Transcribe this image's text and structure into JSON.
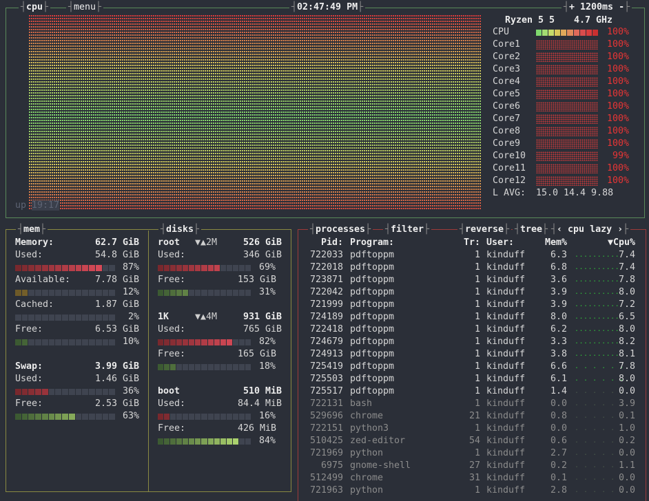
{
  "cpu_box": {
    "title": "cpu",
    "menu": "menu",
    "clock": "02:47:49 PM",
    "refresh": "+ 1200ms -",
    "model": "Ryzen 5 5",
    "freq": "4.7 GHz",
    "uptime_prefix": "up ",
    "uptime": "19:17",
    "cpu_label": "CPU",
    "cpu_pct": "100%",
    "cores": [
      {
        "name": "Core1",
        "pct": "100%"
      },
      {
        "name": "Core2",
        "pct": "100%"
      },
      {
        "name": "Core3",
        "pct": "100%"
      },
      {
        "name": "Core4",
        "pct": "100%"
      },
      {
        "name": "Core5",
        "pct": "100%"
      },
      {
        "name": "Core6",
        "pct": "100%"
      },
      {
        "name": "Core7",
        "pct": "100%"
      },
      {
        "name": "Core8",
        "pct": "100%"
      },
      {
        "name": "Core9",
        "pct": "100%"
      },
      {
        "name": "Core10",
        "pct": "99%"
      },
      {
        "name": "Core11",
        "pct": "100%"
      },
      {
        "name": "Core12",
        "pct": "100%"
      }
    ],
    "lavg_label": "L AVG:",
    "lavg": "15.0 14.4 9.88",
    "colors": {
      "low": "#7fd96e",
      "mid": "#d9c85a",
      "high": "#d83c3c"
    }
  },
  "mem": {
    "title": "mem",
    "memory_label": "Memory:",
    "memory_total": "62.7 GiB",
    "used_label": "Used:",
    "used_value": "54.8 GiB",
    "used_pct": "87%",
    "used_level": 0.87,
    "available_label": "Available:",
    "available_value": "7.78 GiB",
    "available_pct": "12%",
    "available_level": 0.12,
    "cached_label": "Cached:",
    "cached_value": "1.87 GiB",
    "cached_pct": "2%",
    "cached_level": 0.02,
    "free_label": "Free:",
    "free_value": "6.53 GiB",
    "free_pct": "10%",
    "free_level": 0.1,
    "swap_label": "Swap:",
    "swap_total": "3.99 GiB",
    "swap_used_label": "Used:",
    "swap_used_value": "1.46 GiB",
    "swap_used_pct": "36%",
    "swap_used_level": 0.36,
    "swap_free_label": "Free:",
    "swap_free_value": "2.53 GiB",
    "swap_free_pct": "63%",
    "swap_free_level": 0.63
  },
  "disks": {
    "title": "disks",
    "list": [
      {
        "name": "root",
        "io": "▼▲2M",
        "total": "526 GiB",
        "used_label": "Used:",
        "used": "346 GiB",
        "used_pct": "69%",
        "used_level": 0.69,
        "free_label": "Free:",
        "free": "153 GiB",
        "free_pct": "31%",
        "free_level": 0.31
      },
      {
        "name": "1K",
        "io": "▼▲4M",
        "total": "931 GiB",
        "used_label": "Used:",
        "used": "765 GiB",
        "used_pct": "82%",
        "used_level": 0.82,
        "free_label": "Free:",
        "free": "165 GiB",
        "free_pct": "18%",
        "free_level": 0.18
      },
      {
        "name": "boot",
        "io": "",
        "total": "510 MiB",
        "used_label": "Used:",
        "used": "84.4 MiB",
        "used_pct": "16%",
        "used_level": 0.16,
        "free_label": "Free:",
        "free": "426 MiB",
        "free_pct": "84%",
        "free_level": 0.84
      }
    ]
  },
  "proc": {
    "title": "processes",
    "filter": "filter",
    "reverse": "reverse",
    "tree": "tree",
    "mode_prev": "‹",
    "mode": "cpu lazy",
    "mode_next": "›",
    "headers": {
      "pid": "Pid:",
      "program": "Program:",
      "threads": "Tr:",
      "user": "User:",
      "mem": "Mem%",
      "cpu": "▼Cpu%"
    },
    "rows": [
      {
        "pid": "722033",
        "program": "pdftoppm",
        "threads": "1",
        "user": "kinduff",
        "mem": "6.3",
        "spark": "..........",
        "active": true,
        "cpu": "7.4"
      },
      {
        "pid": "722018",
        "program": "pdftoppm",
        "threads": "1",
        "user": "kinduff",
        "mem": "6.8",
        "spark": "..........",
        "active": true,
        "cpu": "7.4"
      },
      {
        "pid": "723871",
        "program": "pdftoppm",
        "threads": "1",
        "user": "kinduff",
        "mem": "3.6",
        "spark": "..........",
        "active": true,
        "cpu": "7.8"
      },
      {
        "pid": "722042",
        "program": "pdftoppm",
        "threads": "1",
        "user": "kinduff",
        "mem": "3.9",
        "spark": "..........",
        "active": true,
        "cpu": "8.0"
      },
      {
        "pid": "721999",
        "program": "pdftoppm",
        "threads": "1",
        "user": "kinduff",
        "mem": "3.9",
        "spark": "..........",
        "active": true,
        "cpu": "7.2"
      },
      {
        "pid": "724189",
        "program": "pdftoppm",
        "threads": "1",
        "user": "kinduff",
        "mem": "8.0",
        "spark": "..........",
        "active": true,
        "cpu": "6.5"
      },
      {
        "pid": "722418",
        "program": "pdftoppm",
        "threads": "1",
        "user": "kinduff",
        "mem": "6.2",
        "spark": "..........",
        "active": true,
        "cpu": "8.0"
      },
      {
        "pid": "724679",
        "program": "pdftoppm",
        "threads": "1",
        "user": "kinduff",
        "mem": "3.3",
        "spark": "..........",
        "active": true,
        "cpu": "8.2"
      },
      {
        "pid": "724913",
        "program": "pdftoppm",
        "threads": "1",
        "user": "kinduff",
        "mem": "3.8",
        "spark": "..........",
        "active": true,
        "cpu": "8.1"
      },
      {
        "pid": "725419",
        "program": "pdftoppm",
        "threads": "1",
        "user": "kinduff",
        "mem": "6.6",
        "spark": ". . . . . .",
        "active": true,
        "cpu": "7.8"
      },
      {
        "pid": "725503",
        "program": "pdftoppm",
        "threads": "1",
        "user": "kinduff",
        "mem": "6.1",
        "spark": ". . . . . .",
        "active": true,
        "cpu": "8.0"
      },
      {
        "pid": "725517",
        "program": "pdftoppm",
        "threads": "1",
        "user": "kinduff",
        "mem": "1.4",
        "spark": ". . . . . .",
        "active": false,
        "cpu": "0.0"
      },
      {
        "pid": "722131",
        "program": "bash",
        "threads": "1",
        "user": "kinduff",
        "mem": "0.0",
        "spark": ". . . . . .",
        "active": false,
        "cpu": "3.9"
      },
      {
        "pid": "529696",
        "program": "chrome",
        "threads": "21",
        "user": "kinduff",
        "mem": "0.8",
        "spark": ". . . . . .",
        "active": false,
        "cpu": "0.1"
      },
      {
        "pid": "722151",
        "program": "python3",
        "threads": "1",
        "user": "kinduff",
        "mem": "0.0",
        "spark": ". . . . . .",
        "active": false,
        "cpu": "1.0"
      },
      {
        "pid": "510425",
        "program": "zed-editor",
        "threads": "54",
        "user": "kinduff",
        "mem": "0.6",
        "spark": ". . . . . .",
        "active": false,
        "cpu": "0.2"
      },
      {
        "pid": "721969",
        "program": "python",
        "threads": "1",
        "user": "kinduff",
        "mem": "2.7",
        "spark": ". . . . . .",
        "active": false,
        "cpu": "0.0"
      },
      {
        "pid": "6975",
        "program": "gnome-shell",
        "threads": "27",
        "user": "kinduff",
        "mem": "0.2",
        "spark": ". . . . . .",
        "active": false,
        "cpu": "1.1"
      },
      {
        "pid": "512499",
        "program": "chrome",
        "threads": "31",
        "user": "kinduff",
        "mem": "0.1",
        "spark": ". . . . . .",
        "active": false,
        "cpu": "0.0"
      },
      {
        "pid": "721963",
        "program": "python",
        "threads": "1",
        "user": "kinduff",
        "mem": "2.8",
        "spark": ". . . . . .",
        "active": false,
        "cpu": "0.0"
      }
    ]
  }
}
